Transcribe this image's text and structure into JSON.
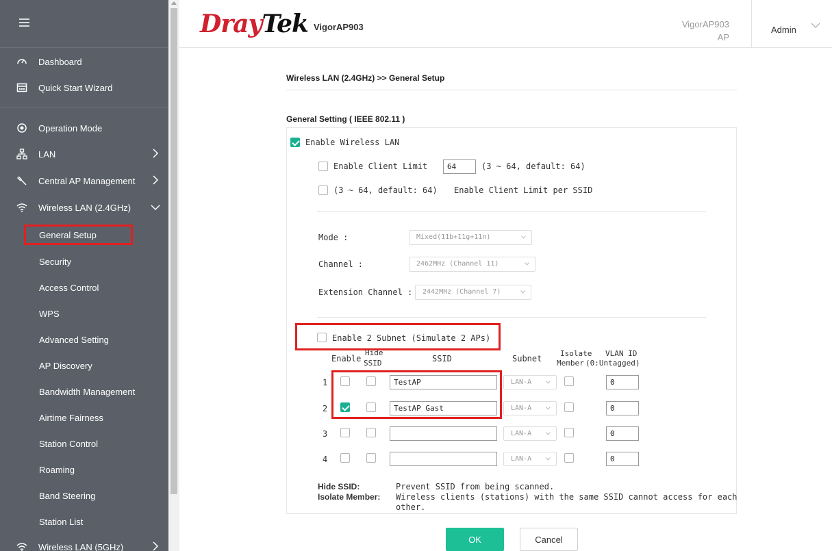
{
  "sidebar": {
    "items": [
      {
        "label": "Dashboard",
        "icon": "gauge-icon"
      },
      {
        "label": "Quick Start Wizard",
        "icon": "wizard-icon"
      },
      {
        "label": "Operation Mode",
        "icon": "mode-icon"
      },
      {
        "label": "LAN",
        "icon": "network-icon"
      },
      {
        "label": "Central AP Management",
        "icon": "wrench-icon"
      },
      {
        "label": "Wireless LAN (2.4GHz)",
        "icon": "wifi-icon"
      }
    ],
    "subitems": [
      "General Setup",
      "Security",
      "Access Control",
      "WPS",
      "Advanced Setting",
      "AP Discovery",
      "Bandwidth Management",
      "Airtime Fairness",
      "Station Control",
      "Roaming",
      "Band Steering",
      "Station List"
    ],
    "bottom_item": {
      "label": "Wireless LAN (5GHz)",
      "icon": "wifi-icon"
    }
  },
  "header": {
    "logo_dray": "Dray",
    "logo_tek": "Tek",
    "model": "VigorAP903",
    "model_right_line1": "VigorAP903",
    "model_right_line2": "AP",
    "user": "Admin"
  },
  "main": {
    "breadcrumb": "Wireless LAN (2.4GHz) >> General Setup",
    "section_title": "General Setting ( IEEE 802.11 )",
    "enable_wireless_lan": "Enable Wireless LAN",
    "enable_client_limit": "Enable Client Limit",
    "client_limit_value": "64",
    "client_limit_hint": "(3 ~ 64, default: 64)",
    "per_ssid_hint": "(3 ~ 64, default: 64)",
    "per_ssid_label": "Enable Client Limit per SSID",
    "mode_label": "Mode :",
    "mode_value": "Mixed(11b+11g+11n)",
    "channel_label": "Channel :",
    "channel_value": "2462MHz (Channel 11)",
    "ext_channel_label": "Extension Channel :",
    "ext_channel_value": "2442MHz (Channel 7)",
    "enable_2_subnet": "Enable 2 Subnet (Simulate 2 APs)",
    "table": {
      "headers": {
        "enable": "Enable",
        "hide_ssid_line1": "Hide",
        "hide_ssid_line2": "SSID",
        "ssid": "SSID",
        "subnet": "Subnet",
        "isolate_line1": "Isolate",
        "isolate_line2": "Member",
        "vlan_line1": "VLAN ID",
        "vlan_line2": "(0:Untagged)"
      },
      "rows": [
        {
          "num": "1",
          "enabled": false,
          "hide": false,
          "ssid": "TestAP",
          "subnet": "LAN-A",
          "isolate": false,
          "vlan": "0"
        },
        {
          "num": "2",
          "enabled": true,
          "hide": false,
          "ssid": "TestAP Gast",
          "subnet": "LAN-A",
          "isolate": false,
          "vlan": "0"
        },
        {
          "num": "3",
          "enabled": false,
          "hide": false,
          "ssid": "",
          "subnet": "LAN-A",
          "isolate": false,
          "vlan": "0"
        },
        {
          "num": "4",
          "enabled": false,
          "hide": false,
          "ssid": "",
          "subnet": "LAN-A",
          "isolate": false,
          "vlan": "0"
        }
      ]
    },
    "notes": {
      "hide_ssid_label": "Hide SSID:",
      "hide_ssid_text": "Prevent SSID from being scanned.",
      "isolate_label": "Isolate Member:",
      "isolate_text_line1": "Wireless clients (stations) with the same SSID cannot access for each",
      "isolate_text_line2": "other."
    },
    "ok_label": "OK",
    "cancel_label": "Cancel"
  },
  "colors": {
    "sidebar_bg": "#5b6068",
    "brand_red": "#d1202e",
    "accent_green": "#1aaf92",
    "highlight_red": "#e02020"
  }
}
